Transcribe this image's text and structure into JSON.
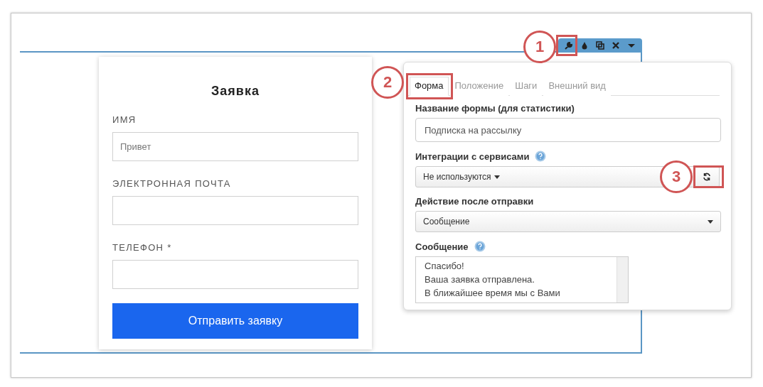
{
  "form_card": {
    "title": "Заявка",
    "fields": [
      {
        "label": "ИМЯ",
        "placeholder": "Привет"
      },
      {
        "label": "ЭЛЕКТРОННАЯ ПОЧТА"
      },
      {
        "label": "ТЕЛЕФОН *"
      }
    ],
    "submit_button": "Отправить заявку"
  },
  "settings_popup": {
    "tabs": [
      {
        "label": "Форма",
        "selected": true
      },
      {
        "label": "Положение",
        "selected": false
      },
      {
        "label": "Шаги",
        "selected": false
      },
      {
        "label": "Внешний вид",
        "selected": false
      }
    ],
    "form_name": {
      "label": "Название формы (для статистики)",
      "value": "Подписка на рассылку"
    },
    "integrations": {
      "label": "Интеграции с сервисами",
      "value": "Не используются"
    },
    "after_submit": {
      "label": "Действие после отправки",
      "value": "Сообщение"
    },
    "message": {
      "label": "Сообщение",
      "lines": [
        "Спасибо!",
        "Ваша заявка отправлена.",
        "В ближайшее время мы с Вами"
      ]
    }
  },
  "annotations": [
    {
      "number": "1"
    },
    {
      "number": "2"
    },
    {
      "number": "3"
    }
  ]
}
